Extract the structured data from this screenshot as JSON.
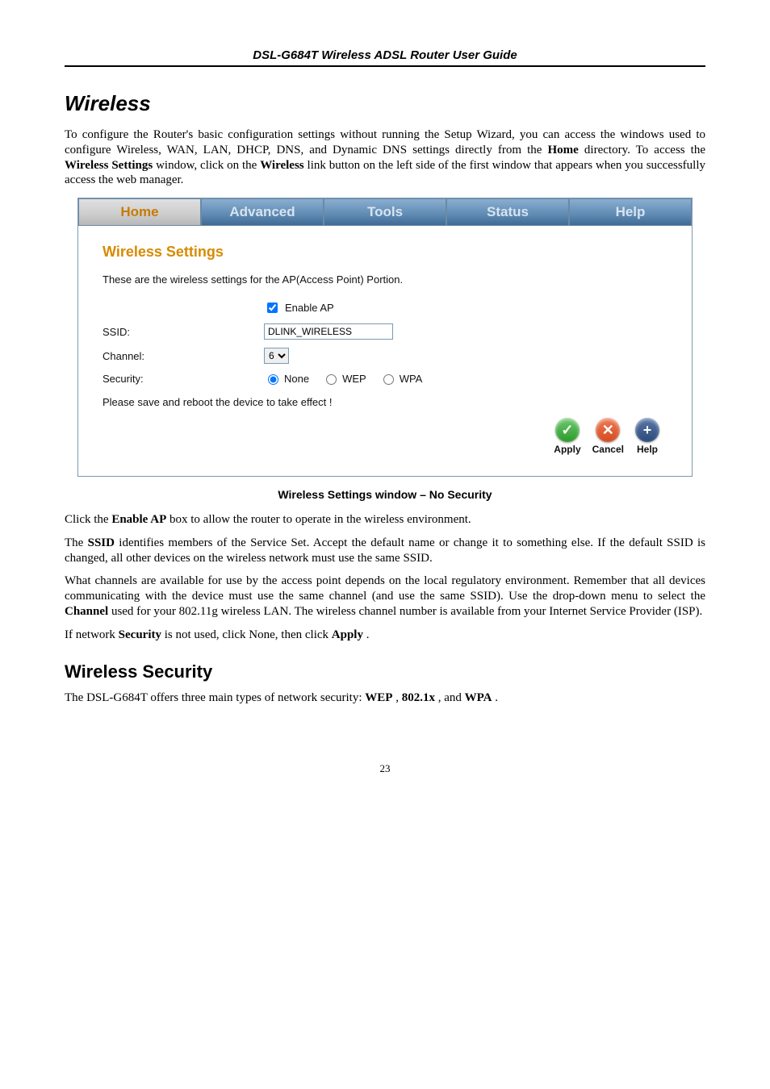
{
  "doc": {
    "header": "DSL-G684T Wireless ADSL Router User Guide",
    "page_number": "23",
    "section_wireless": "Wireless",
    "intro_a": "To configure the Router's basic configuration settings without running the Setup Wizard, you can access the windows used to configure Wireless, WAN, LAN, DHCP, DNS, and Dynamic DNS settings directly from the ",
    "intro_home": "Home",
    "intro_b": " directory. To access the ",
    "intro_ws": "Wireless Settings",
    "intro_c": " window, click on the ",
    "intro_wlink": "Wireless",
    "intro_d": " link button on the left side of the first window that appears when you successfully access the web manager.",
    "caption": "Wireless Settings window – No Security",
    "p2_a": "Click the ",
    "p2_b": "Enable AP",
    "p2_c": " box to allow the router to operate in the wireless environment.",
    "p3_a": "The ",
    "p3_b": "SSID",
    "p3_c": " identifies members of the Service Set. Accept the default name or change it to something else. If the default SSID is changed, all other devices on the wireless network must use the same SSID.",
    "p4_a": "What channels are available for use by the access point depends on the local regulatory environment. Remember that all devices communicating with the device must use the same channel (and use the same SSID). Use the drop-down menu to select the ",
    "p4_b": "Channel",
    "p4_c": " used for your 802.11g wireless LAN. The wireless channel number is available from your Internet Service Provider (ISP).",
    "p5_a": "If network ",
    "p5_b": "Security",
    "p5_c": " is not used, click None, then click ",
    "p5_d": "Apply",
    "p5_e": ".",
    "section_wsec": "Wireless Security",
    "p6_a": "The DSL-G684T offers three main types of network security: ",
    "p6_b": "WEP",
    "p6_c": ", ",
    "p6_d": "802.1x",
    "p6_e": ", and ",
    "p6_f": "WPA",
    "p6_g": "."
  },
  "ui": {
    "tabs": {
      "home": "Home",
      "advanced": "Advanced",
      "tools": "Tools",
      "status": "Status",
      "help": "Help"
    },
    "panel_title": "Wireless Settings",
    "panel_note": "These are the wireless settings for the AP(Access Point) Portion.",
    "enable_ap_label": "Enable AP",
    "enable_ap_checked": true,
    "ssid_label": "SSID:",
    "ssid_value": "DLINK_WIRELESS",
    "channel_label": "Channel:",
    "channel_value": "6",
    "security_label": "Security:",
    "security_opts": {
      "none": "None",
      "wep": "WEP",
      "wpa": "WPA"
    },
    "security_selected": "none",
    "save_note": "Please save and reboot the device to take effect !",
    "btns": {
      "apply": "Apply",
      "cancel": "Cancel",
      "help": "Help"
    }
  }
}
